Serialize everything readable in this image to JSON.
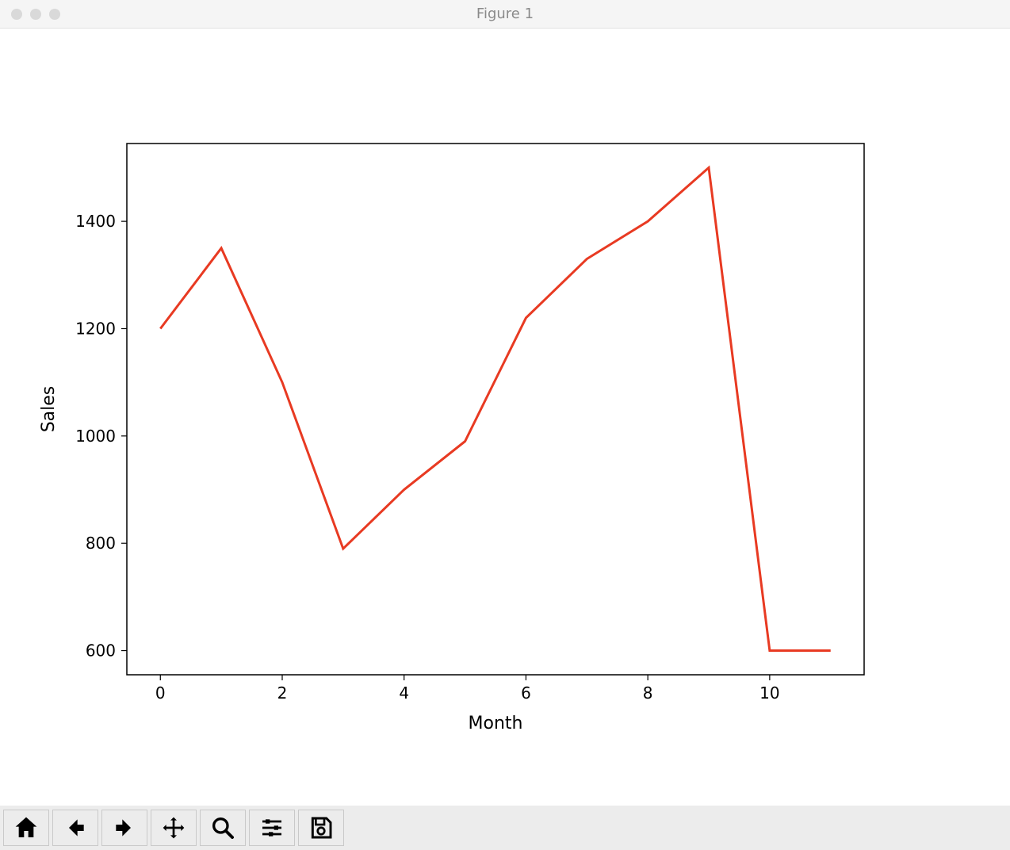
{
  "window": {
    "title": "Figure 1"
  },
  "chart_data": {
    "type": "line",
    "x": [
      0,
      1,
      2,
      3,
      4,
      5,
      6,
      7,
      8,
      9,
      10,
      11
    ],
    "values": [
      1200,
      1350,
      1100,
      790,
      900,
      990,
      1220,
      1330,
      1400,
      1500,
      600,
      600
    ],
    "xlabel": "Month",
    "ylabel": "Sales",
    "xlim": [
      -0.55,
      11.55
    ],
    "ylim": [
      555,
      1545
    ],
    "xticks": [
      0,
      2,
      4,
      6,
      8,
      10
    ],
    "yticks": [
      600,
      800,
      1000,
      1200,
      1400
    ],
    "line_color": "#e83a22",
    "line_width": 3
  },
  "toolbar": {
    "home": "Home",
    "back": "Back",
    "forward": "Forward",
    "pan": "Pan",
    "zoom": "Zoom",
    "configure": "Configure subplots",
    "save": "Save"
  }
}
